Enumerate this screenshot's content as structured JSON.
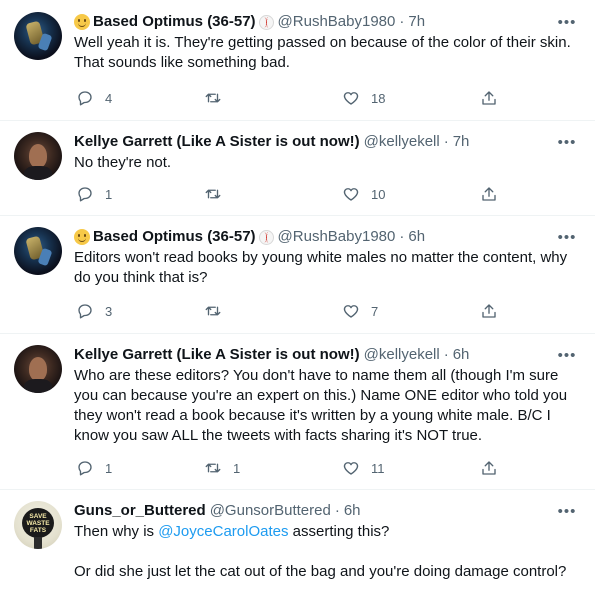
{
  "tweets": [
    {
      "name": "Based Optimus (36-57)",
      "handle": "@RushBaby1980",
      "time": "7h",
      "text": "Well yeah it is. They're getting passed on because of the color of their skin. That sounds like something bad.",
      "replies": "4",
      "retweets": "",
      "likes": "18",
      "avatar": "optimus"
    },
    {
      "name": "Kellye Garrett (Like A Sister is out now!)",
      "handle": "@kellyekell",
      "time": "7h",
      "text": "No they're not.",
      "replies": "1",
      "retweets": "",
      "likes": "10",
      "avatar": "kellye"
    },
    {
      "name": "Based Optimus (36-57)",
      "handle": "@RushBaby1980",
      "time": "6h",
      "text": "Editors won't read books by young white males no matter the content, why do you think that is?",
      "replies": "3",
      "retweets": "",
      "likes": "7",
      "avatar": "optimus"
    },
    {
      "name": "Kellye Garrett (Like A Sister is out now!)",
      "handle": "@kellyekell",
      "time": "6h",
      "text": "Who are these editors? You don't have to name them all (though I'm sure you can because you're an expert on this.) Name ONE editor who told you they won't read a book because it's written by a young white male. B/C I know you saw ALL the tweets with facts sharing it's NOT true.",
      "replies": "1",
      "retweets": "1",
      "likes": "11",
      "avatar": "kellye"
    },
    {
      "name": "Guns_or_Buttered",
      "handle": "@GunsorButtered",
      "time": "6h",
      "text_before": "Then why is ",
      "mention": "@JoyceCarolOates",
      "text_after": " asserting this?\n\nOr did she just let the cat out of the bag and you're doing damage control?",
      "avatar": "guns",
      "avatar_text": "SAVE WASTE FATS"
    }
  ],
  "more_icon": "more-horizontal-icon",
  "dot": "·",
  "icons": [
    "reply-icon",
    "retweet-icon",
    "like-icon",
    "share-icon"
  ]
}
